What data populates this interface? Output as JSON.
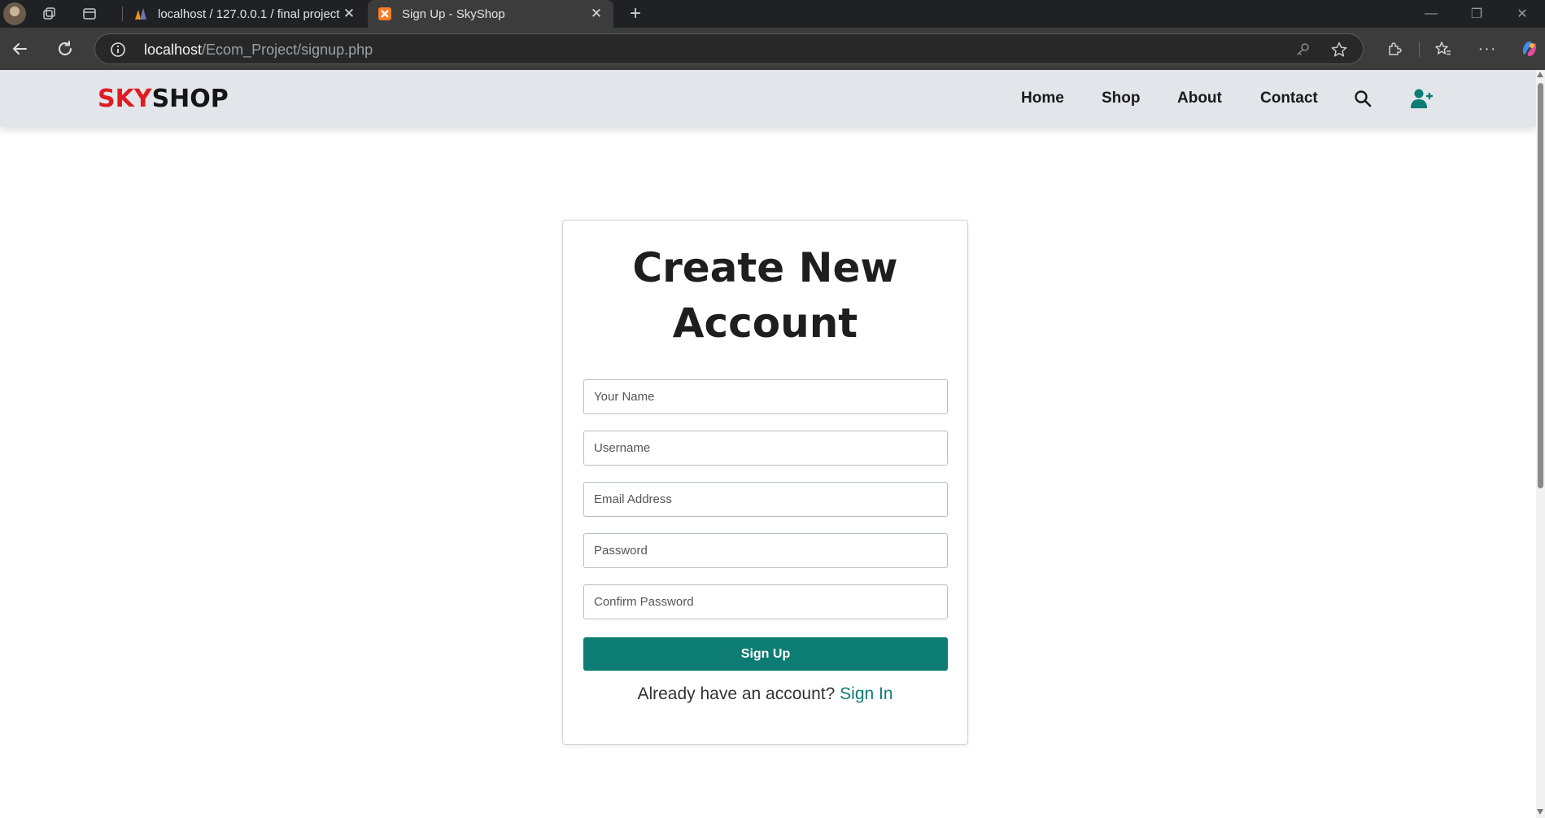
{
  "browser": {
    "tabs": [
      {
        "title": "localhost / 127.0.0.1 / final project",
        "active": false
      },
      {
        "title": "Sign Up - SkyShop",
        "active": true
      }
    ],
    "address": {
      "host": "localhost",
      "path": "/Ecom_Project/signup.php"
    }
  },
  "site": {
    "logo": {
      "part1": "SKY",
      "part2": "SHOP"
    },
    "nav": {
      "home": "Home",
      "shop": "Shop",
      "about": "About",
      "contact": "Contact"
    }
  },
  "signup": {
    "title": "Create New Account",
    "fields": {
      "name": "Your Name",
      "username": "Username",
      "email": "Email Address",
      "password": "Password",
      "confirm": "Confirm Password"
    },
    "submit": "Sign Up",
    "prompt": "Already have an account?",
    "signin_link": "Sign In"
  },
  "colors": {
    "brand_red": "#e01b22",
    "accent_teal": "#0d7c73",
    "header_bg": "#e2e6ea"
  },
  "icons": [
    "search-icon",
    "add-user-icon"
  ]
}
